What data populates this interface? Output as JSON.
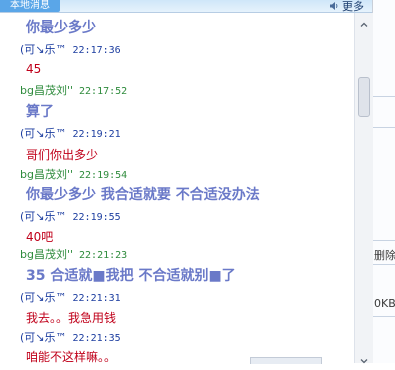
{
  "window": {
    "title_tab": "本地消息",
    "more_label": "更多",
    "speaker_icon": "speaker-icon"
  },
  "messages": [
    {
      "kind": "content",
      "style": "big",
      "text": "你最少多少"
    },
    {
      "kind": "sender",
      "who": "other",
      "name": "(可↘乐™",
      "time": "22:17:36"
    },
    {
      "kind": "content",
      "style": "red",
      "text": "45"
    },
    {
      "kind": "sender",
      "who": "me",
      "name": "bg昌茂刘''",
      "time": "22:17:52"
    },
    {
      "kind": "content",
      "style": "big",
      "text": "算了"
    },
    {
      "kind": "sender",
      "who": "other",
      "name": "(可↘乐™",
      "time": "22:19:21"
    },
    {
      "kind": "content",
      "style": "red",
      "text": "哥们你出多少"
    },
    {
      "kind": "sender",
      "who": "me",
      "name": "bg昌茂刘''",
      "time": "22:19:54"
    },
    {
      "kind": "content",
      "style": "big",
      "text": "你最少多少  我合适就要  不合适没办法"
    },
    {
      "kind": "sender",
      "who": "other",
      "name": "(可↘乐™",
      "time": "22:19:55"
    },
    {
      "kind": "content",
      "style": "red",
      "text": "40吧"
    },
    {
      "kind": "sender",
      "who": "me",
      "name": "bg昌茂刘''",
      "time": "22:21:23"
    },
    {
      "kind": "content",
      "style": "big",
      "text": "35   合适就■我把    不合适就别■了"
    },
    {
      "kind": "sender",
      "who": "other",
      "name": "(可↘乐™",
      "time": "22:21:31"
    },
    {
      "kind": "content",
      "style": "red",
      "text": "我去。。我急用钱"
    },
    {
      "kind": "sender",
      "who": "other",
      "name": "(可↘乐™",
      "time": "22:21:35"
    },
    {
      "kind": "content",
      "style": "red",
      "text": "咱能不这样嘛。。"
    }
  ],
  "side_panel": {
    "delete_label": "删除",
    "size_label": "0KB"
  }
}
